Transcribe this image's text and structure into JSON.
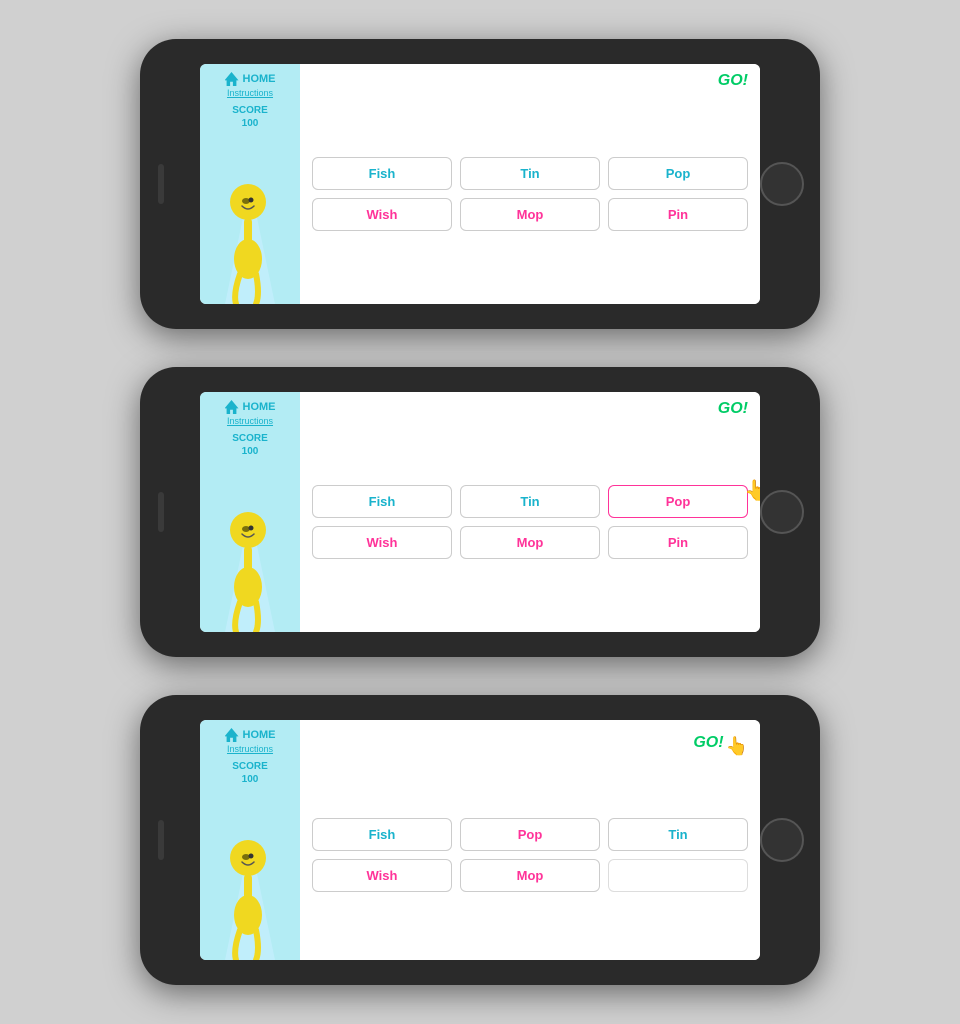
{
  "screens": [
    {
      "id": "screen1",
      "nav": {
        "home_label": "HOME",
        "instructions_label": "Instructions"
      },
      "score": {
        "label": "SCORE",
        "value": "100"
      },
      "go_label": "GO!",
      "words_row1": [
        "Fish",
        "Tin",
        "Pop"
      ],
      "words_row2": [
        "Wish",
        "Mop",
        "Pin"
      ],
      "words_row1_color": "cyan",
      "words_row2_color": "pink",
      "state": "normal"
    },
    {
      "id": "screen2",
      "nav": {
        "home_label": "HOME",
        "instructions_label": "Instructions"
      },
      "score": {
        "label": "SCORE",
        "value": "100"
      },
      "go_label": "GO!",
      "words_row1": [
        "Fish",
        "Tin",
        "Pop"
      ],
      "words_row2": [
        "Wish",
        "Mop",
        "Pin"
      ],
      "state": "dragging",
      "drag_word": "Pop"
    },
    {
      "id": "screen3",
      "nav": {
        "home_label": "HOME",
        "instructions_label": "Instructions"
      },
      "score": {
        "label": "SCORE",
        "value": "100"
      },
      "go_label": "GO!",
      "words_row1": [
        "Fish",
        "Pop",
        "Tin"
      ],
      "words_row2": [
        "Wish",
        "Mop",
        ""
      ],
      "state": "go-hover"
    }
  ]
}
